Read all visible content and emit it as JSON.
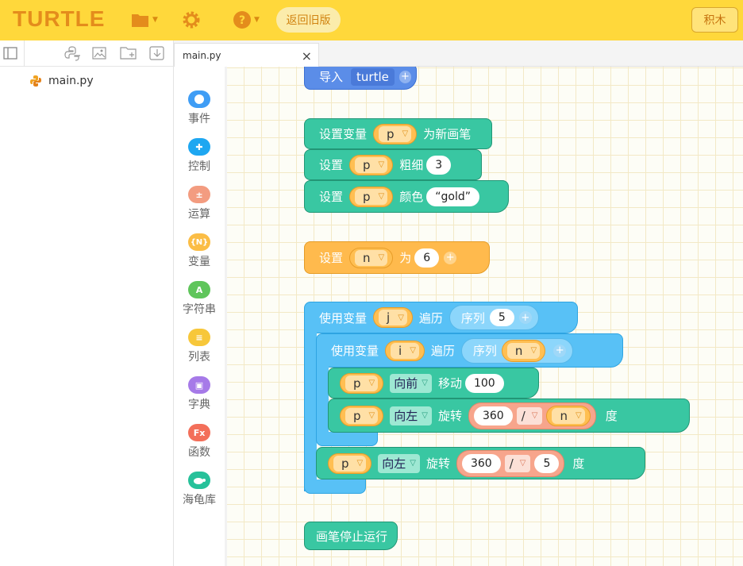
{
  "app": {
    "logo": "TURTLE",
    "back_old": "返回旧版",
    "blocks_label": "积木"
  },
  "file_tree": {
    "items": [
      {
        "name": "main.py"
      }
    ]
  },
  "tab": {
    "name": "main.py",
    "close": "×"
  },
  "palette": [
    {
      "label": "事件",
      "color": "#3f9df5",
      "glyph": ""
    },
    {
      "label": "控制",
      "color": "#1ea7f1",
      "glyph": "+"
    },
    {
      "label": "运算",
      "color": "#f39c80",
      "glyph": "±"
    },
    {
      "label": "变量",
      "color": "#fbbd45",
      "glyph": "{N}"
    },
    {
      "label": "字符串",
      "color": "#5fc55b",
      "glyph": "A"
    },
    {
      "label": "列表",
      "color": "#f7c73a",
      "glyph": "≡"
    },
    {
      "label": "字典",
      "color": "#a67ae8",
      "glyph": "▣"
    },
    {
      "label": "函数",
      "color": "#f36f5a",
      "glyph": "Fx"
    },
    {
      "label": "海龟库",
      "color": "#27c19a",
      "glyph": "🐢"
    }
  ],
  "code": {
    "import": {
      "kw": "导入",
      "module": "turtle"
    },
    "set_pen": {
      "kw": "设置变量",
      "var": "p",
      "suffix": "为新画笔"
    },
    "set_width": {
      "kw": "设置",
      "var": "p",
      "prop": "粗细",
      "value": "3"
    },
    "set_color": {
      "kw": "设置",
      "var": "p",
      "prop": "颜色",
      "value": "“gold”"
    },
    "set_n": {
      "kw": "设置",
      "var": "n",
      "to": "为",
      "value": "6"
    },
    "loop_j": {
      "kw": "使用变量",
      "var": "j",
      "iter": "遍历",
      "seq": "序列",
      "seq_val": "5"
    },
    "loop_i": {
      "kw": "使用变量",
      "var": "i",
      "iter": "遍历",
      "seq": "序列",
      "seq_val": "n"
    },
    "forward": {
      "var": "p",
      "dir": "向前",
      "action": "移动",
      "value": "100"
    },
    "turn_inner": {
      "var": "p",
      "dir": "向左",
      "action": "旋转",
      "num": "360",
      "op": "/",
      "den": "n",
      "unit": "度"
    },
    "turn_outer": {
      "var": "p",
      "dir": "向左",
      "action": "旋转",
      "num": "360",
      "op": "/",
      "den": "5",
      "unit": "度"
    },
    "done": {
      "kw": "画笔停止运行"
    }
  }
}
